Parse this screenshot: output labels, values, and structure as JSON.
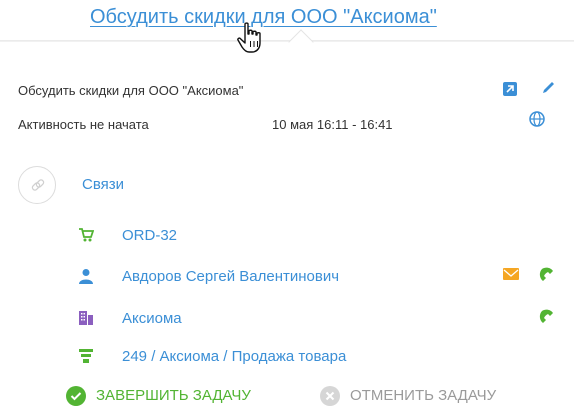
{
  "header": {
    "link_text": "Обсудить скидки для ООО \"Аксиома\""
  },
  "activity": {
    "title": "Обсудить скидки для ООО \"Аксиома\"",
    "status": "Активность не начата",
    "time": "10 мая 16:11 - 16:41"
  },
  "links": {
    "label": "Связи",
    "items": [
      {
        "icon": "cart-icon",
        "label": "ORD-32",
        "color": "#52b433"
      },
      {
        "icon": "person-icon",
        "label": "Авдоров Сергей Валентинович",
        "color": "#3b8fd6"
      },
      {
        "icon": "building-icon",
        "label": "Аксиома",
        "color": "#8b5fbf"
      },
      {
        "icon": "funnel-icon",
        "label": "249 / Аксиома / Продажа товара",
        "color": "#52b433"
      }
    ]
  },
  "actions": {
    "complete": "ЗАВЕРШИТЬ ЗАДАЧУ",
    "cancel": "ОТМЕНИТЬ ЗАДАЧУ"
  },
  "colors": {
    "link": "#3b8fd6",
    "green": "#52b433",
    "orange": "#f5a623",
    "gray": "#cccccc"
  }
}
